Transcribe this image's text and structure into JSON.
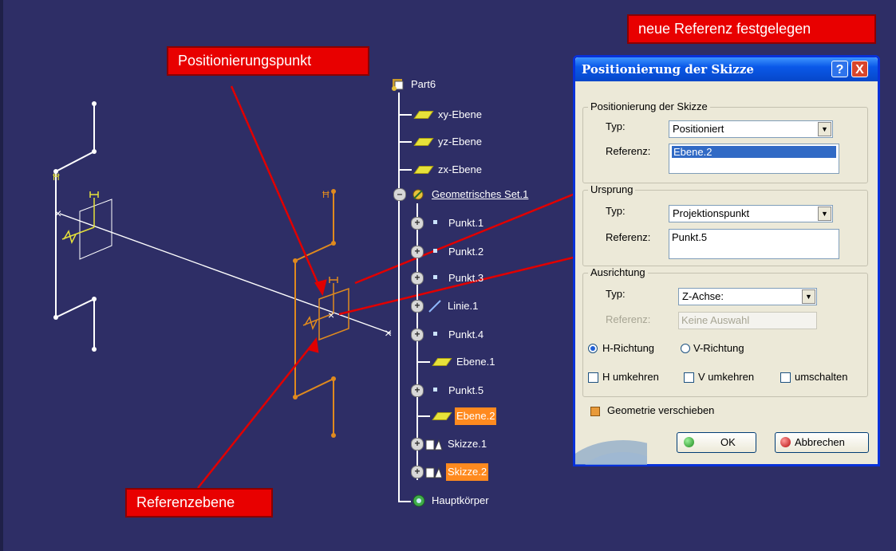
{
  "callouts": {
    "top_right": "neue Referenz festgelegen",
    "point": "Positionierungspunkt",
    "plane": "Referenzebene"
  },
  "tree": {
    "root": "Part6",
    "items": [
      {
        "label": "xy-Ebene"
      },
      {
        "label": "yz-Ebene"
      },
      {
        "label": "zx-Ebene"
      },
      {
        "label": "Geometrisches Set.1"
      },
      {
        "label": "Punkt.1"
      },
      {
        "label": "Punkt.2"
      },
      {
        "label": "Punkt.3"
      },
      {
        "label": "Linie.1"
      },
      {
        "label": "Punkt.4"
      },
      {
        "label": "Ebene.1"
      },
      {
        "label": "Punkt.5"
      },
      {
        "label": "Ebene.2"
      },
      {
        "label": "Skizze.1"
      },
      {
        "label": "Skizze.2"
      },
      {
        "label": "Hauptkörper"
      }
    ]
  },
  "dialog": {
    "title": "Positionierung der Skizze",
    "help": "?",
    "close": "X",
    "placement": {
      "group": "Positionierung der Skizze",
      "type_label": "Typ:",
      "type_value": "Positioniert",
      "ref_label": "Referenz:",
      "ref_value": "Ebene.2"
    },
    "origin": {
      "group": "Ursprung",
      "type_label": "Typ:",
      "type_value": "Projektionspunkt",
      "ref_label": "Referenz:",
      "ref_value": "Punkt.5"
    },
    "orientation": {
      "group": "Ausrichtung",
      "type_label": "Typ:",
      "type_value": "Z-Achse:",
      "ref_label": "Referenz:",
      "ref_value": "Keine Auswahl",
      "h_direction": "H-Richtung",
      "v_direction": "V-Richtung",
      "h_reverse": "H umkehren",
      "v_reverse": "V umkehren",
      "swap": "umschalten"
    },
    "move_geometry": "Geometrie verschieben",
    "ok": "OK",
    "cancel": "Abbrechen"
  },
  "colors": {
    "background": "#2e2e66",
    "callout": "#e80000",
    "selection": "#ff8a1f",
    "sketch_white": "#ffffff",
    "sketch_orange": "#e08a1e"
  }
}
